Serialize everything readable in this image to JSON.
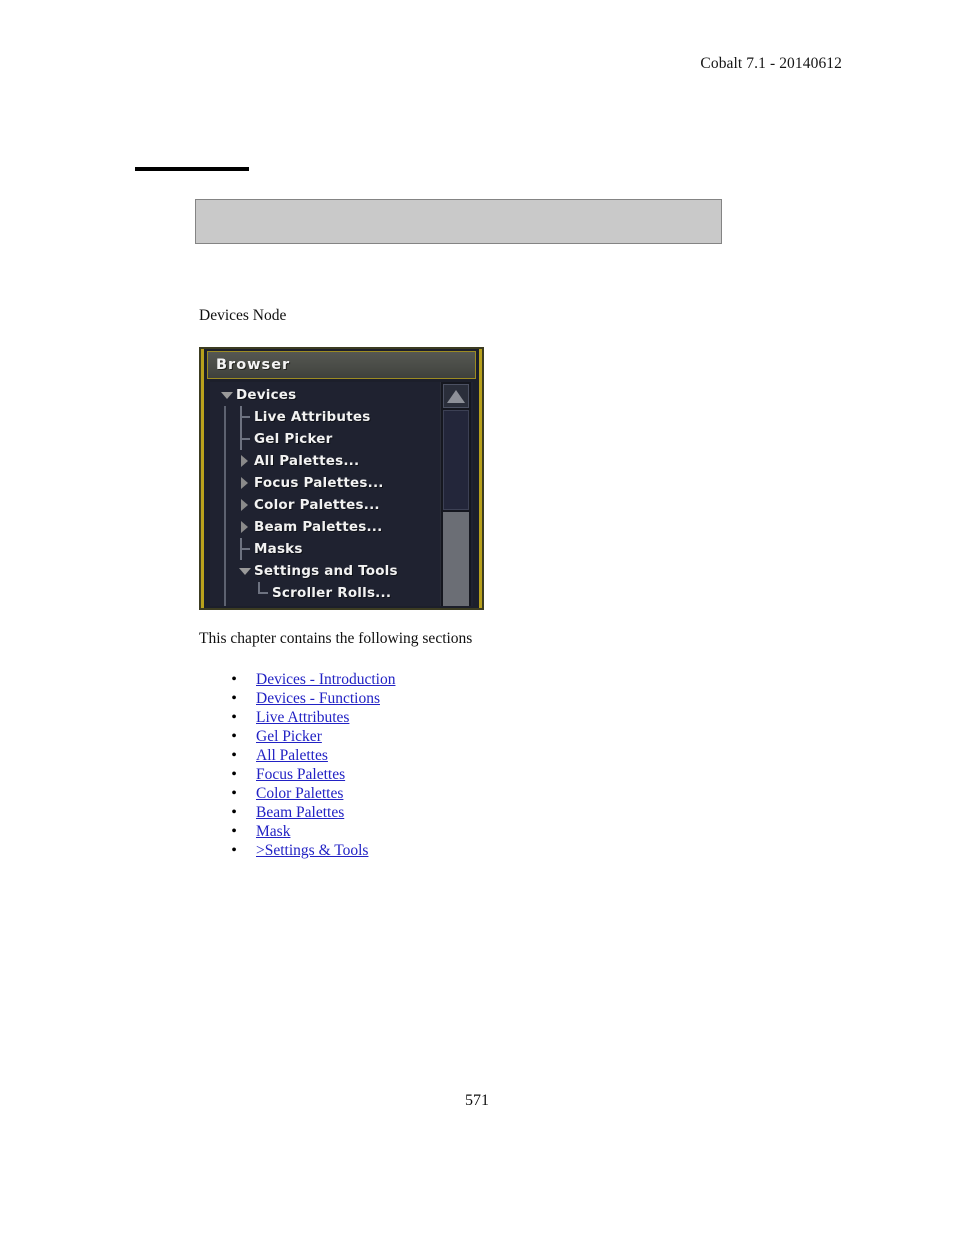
{
  "header": {
    "text": "Cobalt 7.1 - 20140612"
  },
  "chapter": {
    "rule_present": true,
    "gray_panel_text": ""
  },
  "figure": {
    "caption": "Devices Node",
    "browser": {
      "title": "Browser",
      "tree": [
        {
          "label": "Devices",
          "indent": 1,
          "knob": "tri-down"
        },
        {
          "label": "Live Attributes",
          "indent": 2,
          "knob": "tee"
        },
        {
          "label": "Gel Picker",
          "indent": 2,
          "knob": "tee"
        },
        {
          "label": "All Palettes...",
          "indent": 2,
          "knob": "tri-right"
        },
        {
          "label": "Focus Palettes...",
          "indent": 2,
          "knob": "tri-right"
        },
        {
          "label": "Color Palettes...",
          "indent": 2,
          "knob": "tri-right"
        },
        {
          "label": "Beam Palettes...",
          "indent": 2,
          "knob": "tri-right"
        },
        {
          "label": "Masks",
          "indent": 2,
          "knob": "tee"
        },
        {
          "label": "Settings and Tools",
          "indent": 2,
          "knob": "tri-down"
        },
        {
          "label": "Scroller Rolls...",
          "indent": 3,
          "knob": "elbow"
        }
      ],
      "scrollbar": {
        "up_arrow": "scroll-up-arrow-icon"
      },
      "colors": {
        "frame_border": "#b8a11c",
        "titlebar": "#4a4c47",
        "body_background": "#1f2230",
        "label_text": "#f2f2f2",
        "thumb": "#6b6e75"
      }
    }
  },
  "body": {
    "intro": "This chapter contains the following sections",
    "links": [
      "Devices - Introduction",
      "Devices - Functions",
      "Live Attributes",
      "Gel Picker",
      "All Palettes",
      "Focus Palettes",
      "Color Palettes",
      "Beam Palettes",
      "Mask",
      ">Settings & Tools"
    ],
    "bullet_glyph": "•",
    "link_color": "#2222c4"
  },
  "footer": {
    "page_number": "571"
  }
}
